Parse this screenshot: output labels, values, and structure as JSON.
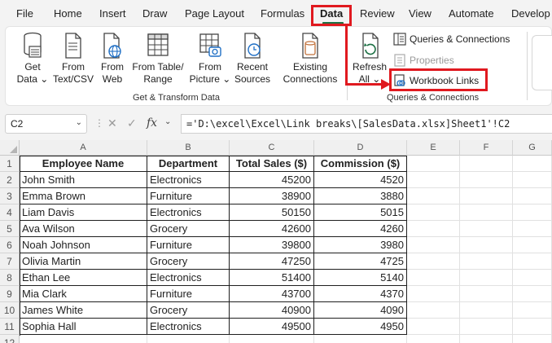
{
  "menu": {
    "tabs": [
      "File",
      "Home",
      "Insert",
      "Draw",
      "Page Layout",
      "Formulas",
      "Data",
      "Review",
      "View",
      "Automate",
      "Develop"
    ],
    "active": "Data"
  },
  "ribbon": {
    "get_data": {
      "line1": "Get",
      "line2": "Data ⌄"
    },
    "from_text_csv": {
      "line1": "From",
      "line2": "Text/CSV"
    },
    "from_web": {
      "line1": "From",
      "line2": "Web"
    },
    "from_table_range": {
      "line1": "From Table/",
      "line2": "Range"
    },
    "from_picture": {
      "line1": "From",
      "line2": "Picture ⌄"
    },
    "recent_sources": {
      "line1": "Recent",
      "line2": "Sources"
    },
    "existing_connections": {
      "line1": "Existing",
      "line2": "Connections"
    },
    "refresh_all": {
      "line1": "Refresh",
      "line2": "All ⌄"
    },
    "queries_connections": "Queries & Connections",
    "properties": "Properties",
    "workbook_links": "Workbook Links",
    "group_get_transform": "Get & Transform Data",
    "group_queries": "Queries & Connections"
  },
  "formula_bar": {
    "name_box": "C2",
    "fx": "fx",
    "formula": "='D:\\excel\\Excel\\Link breaks\\[SalesData.xlsx]Sheet1'!C2"
  },
  "grid": {
    "columns": [
      "A",
      "B",
      "C",
      "D",
      "E",
      "F",
      "G"
    ],
    "rows": [
      "1",
      "2",
      "3",
      "4",
      "5",
      "6",
      "7",
      "8",
      "9",
      "10",
      "11",
      "12"
    ],
    "headers": [
      "Employee Name",
      "Department",
      "Total Sales ($)",
      "Commission ($)"
    ],
    "data": [
      [
        "John Smith",
        "Electronics",
        "45200",
        "4520"
      ],
      [
        "Emma Brown",
        "Furniture",
        "38900",
        "3880"
      ],
      [
        "Liam Davis",
        "Electronics",
        "50150",
        "5015"
      ],
      [
        "Ava Wilson",
        "Grocery",
        "42600",
        "4260"
      ],
      [
        "Noah Johnson",
        "Furniture",
        "39800",
        "3980"
      ],
      [
        "Olivia Martin",
        "Grocery",
        "47250",
        "4725"
      ],
      [
        "Ethan Lee",
        "Electronics",
        "51400",
        "5140"
      ],
      [
        "Mia Clark",
        "Furniture",
        "43700",
        "4370"
      ],
      [
        "James White",
        "Grocery",
        "40900",
        "4090"
      ],
      [
        "Sophia Hall",
        "Electronics",
        "49500",
        "4950"
      ]
    ]
  },
  "colors": {
    "highlight": "#e0191f",
    "excel_green": "#1e7145"
  }
}
